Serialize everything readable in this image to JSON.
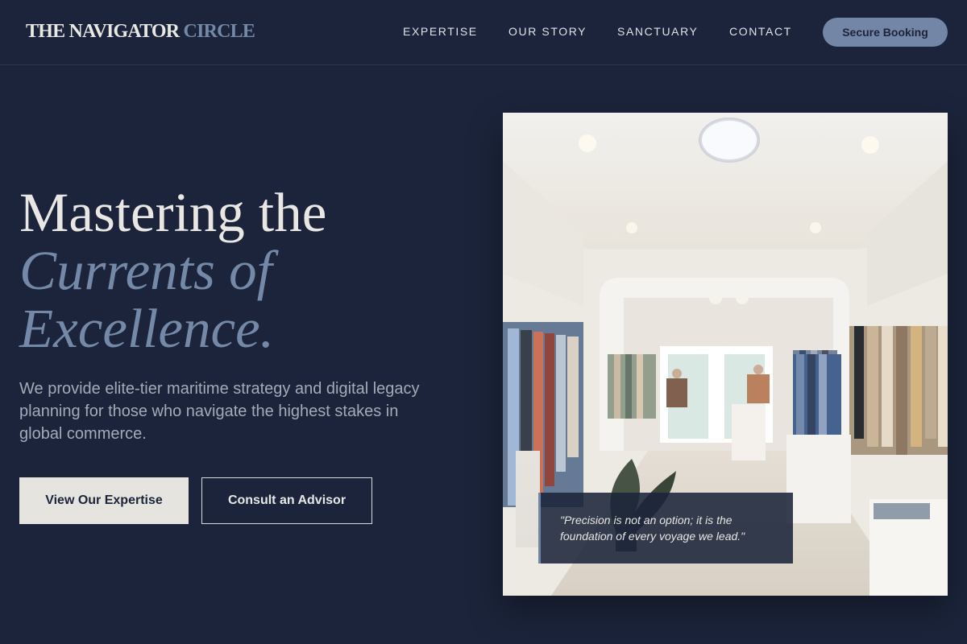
{
  "brand": {
    "name_main": "THE NAVIGATOR",
    "name_accent": "CIRCLE"
  },
  "nav": {
    "items": [
      {
        "label": "EXPERTISE"
      },
      {
        "label": "OUR STORY"
      },
      {
        "label": "SANCTUARY"
      },
      {
        "label": "CONTACT"
      }
    ],
    "cta_label": "Secure Booking"
  },
  "hero": {
    "headline_line1": "Mastering the",
    "headline_line2": "Currents of",
    "headline_line3": "Excellence.",
    "lede": "We provide elite-tier maritime strategy and digital legacy planning for those who navigate the highest stakes in global commerce.",
    "primary_button": "View Our Expertise",
    "secondary_button": "Consult an Advisor"
  },
  "feature": {
    "quote": "\"Precision is not an option; it is the foundation of every voyage we lead.\""
  },
  "colors": {
    "background": "#1b243a",
    "accent": "#7386a6",
    "light": "#e5e4df"
  }
}
